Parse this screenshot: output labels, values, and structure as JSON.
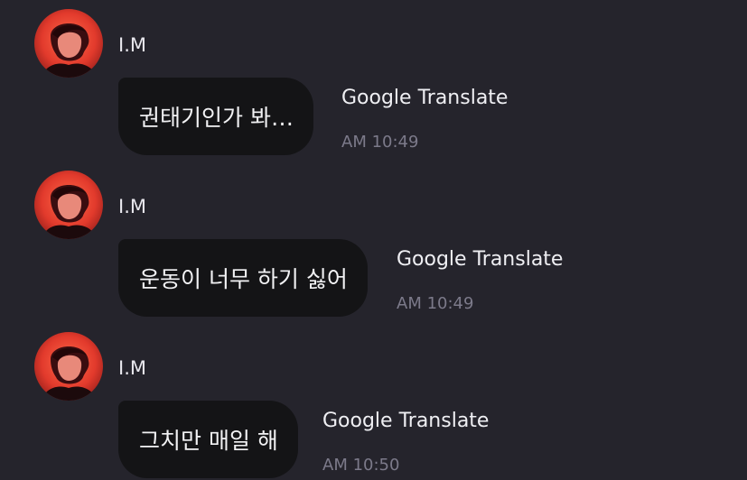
{
  "messages": [
    {
      "sender": "I.M",
      "text": "권태기인가 봐…",
      "action": "Google Translate",
      "time": "AM 10:49"
    },
    {
      "sender": "I.M",
      "text": "운동이 너무 하기 싫어",
      "action": "Google Translate",
      "time": "AM 10:49"
    },
    {
      "sender": "I.M",
      "text": "그치만 매일 해",
      "action": "Google Translate",
      "time": "AM 10:50"
    }
  ],
  "colors": {
    "background": "#25242c",
    "bubble": "#141416",
    "time": "#7c7a8a",
    "avatar_accent": "#e84a3a"
  },
  "icons": {
    "avatar": "profile-photo"
  }
}
